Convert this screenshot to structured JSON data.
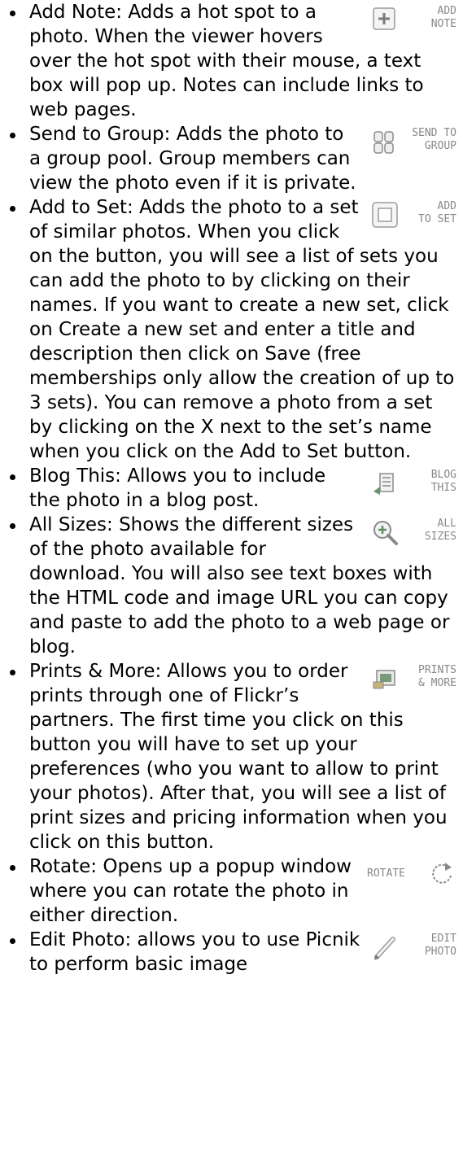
{
  "items": [
    {
      "icon_label": "ADD\nNOTE",
      "icon_name": "add-note-icon",
      "text": "Add Note: Adds a hot spot to a photo. When the viewer hovers over the hot spot with their mouse, a text box will pop up. Notes can include links to web pages."
    },
    {
      "icon_label": "SEND TO\nGROUP",
      "icon_name": "send-to-group-icon",
      "text": "Send to Group: Adds the photo to a group pool. Group members can view the photo even if it is private."
    },
    {
      "icon_label": "ADD\nTO SET",
      "icon_name": "add-to-set-icon",
      "text": "Add to Set: Adds the photo to a set of similar photos. When you click on the button, you will see a list of sets you can add the photo to by clicking on their names. If you want to create a new set, click on Create a new set and enter a title and description then click on Save (free memberships only allow the creation of up to 3 sets). You can remove a photo from a set by clicking on the X next to the set’s name when you click on the Add to Set button."
    },
    {
      "icon_label": "BLOG\nTHIS",
      "icon_name": "blog-this-icon",
      "text": "Blog This: Allows you to include the photo in a blog post."
    },
    {
      "icon_label": "ALL\nSIZES",
      "icon_name": "all-sizes-icon",
      "text": "All Sizes: Shows the different sizes of the photo available for download. You will also see text boxes with the HTML code and image URL you can copy and paste to add the photo to a web page or blog."
    },
    {
      "icon_label": "PRINTS\n& MORE",
      "icon_name": "prints-and-more-icon",
      "text": "Prints & More: Allows you to order prints through one of Flickr’s partners. The first time you click on this button you will have to set up your preferences (who you want to allow to print your photos). After that, you will see a list of print sizes and pricing information when you click on this button."
    },
    {
      "icon_label": "ROTATE",
      "icon_name": "rotate-icon",
      "text": "Rotate: Opens up a popup window where you can rotate the photo in either direction."
    },
    {
      "icon_label": "EDIT\nPHOTO",
      "icon_name": "edit-photo-icon",
      "text": "Edit Photo: allows you to use Picnik to perform basic image"
    }
  ]
}
